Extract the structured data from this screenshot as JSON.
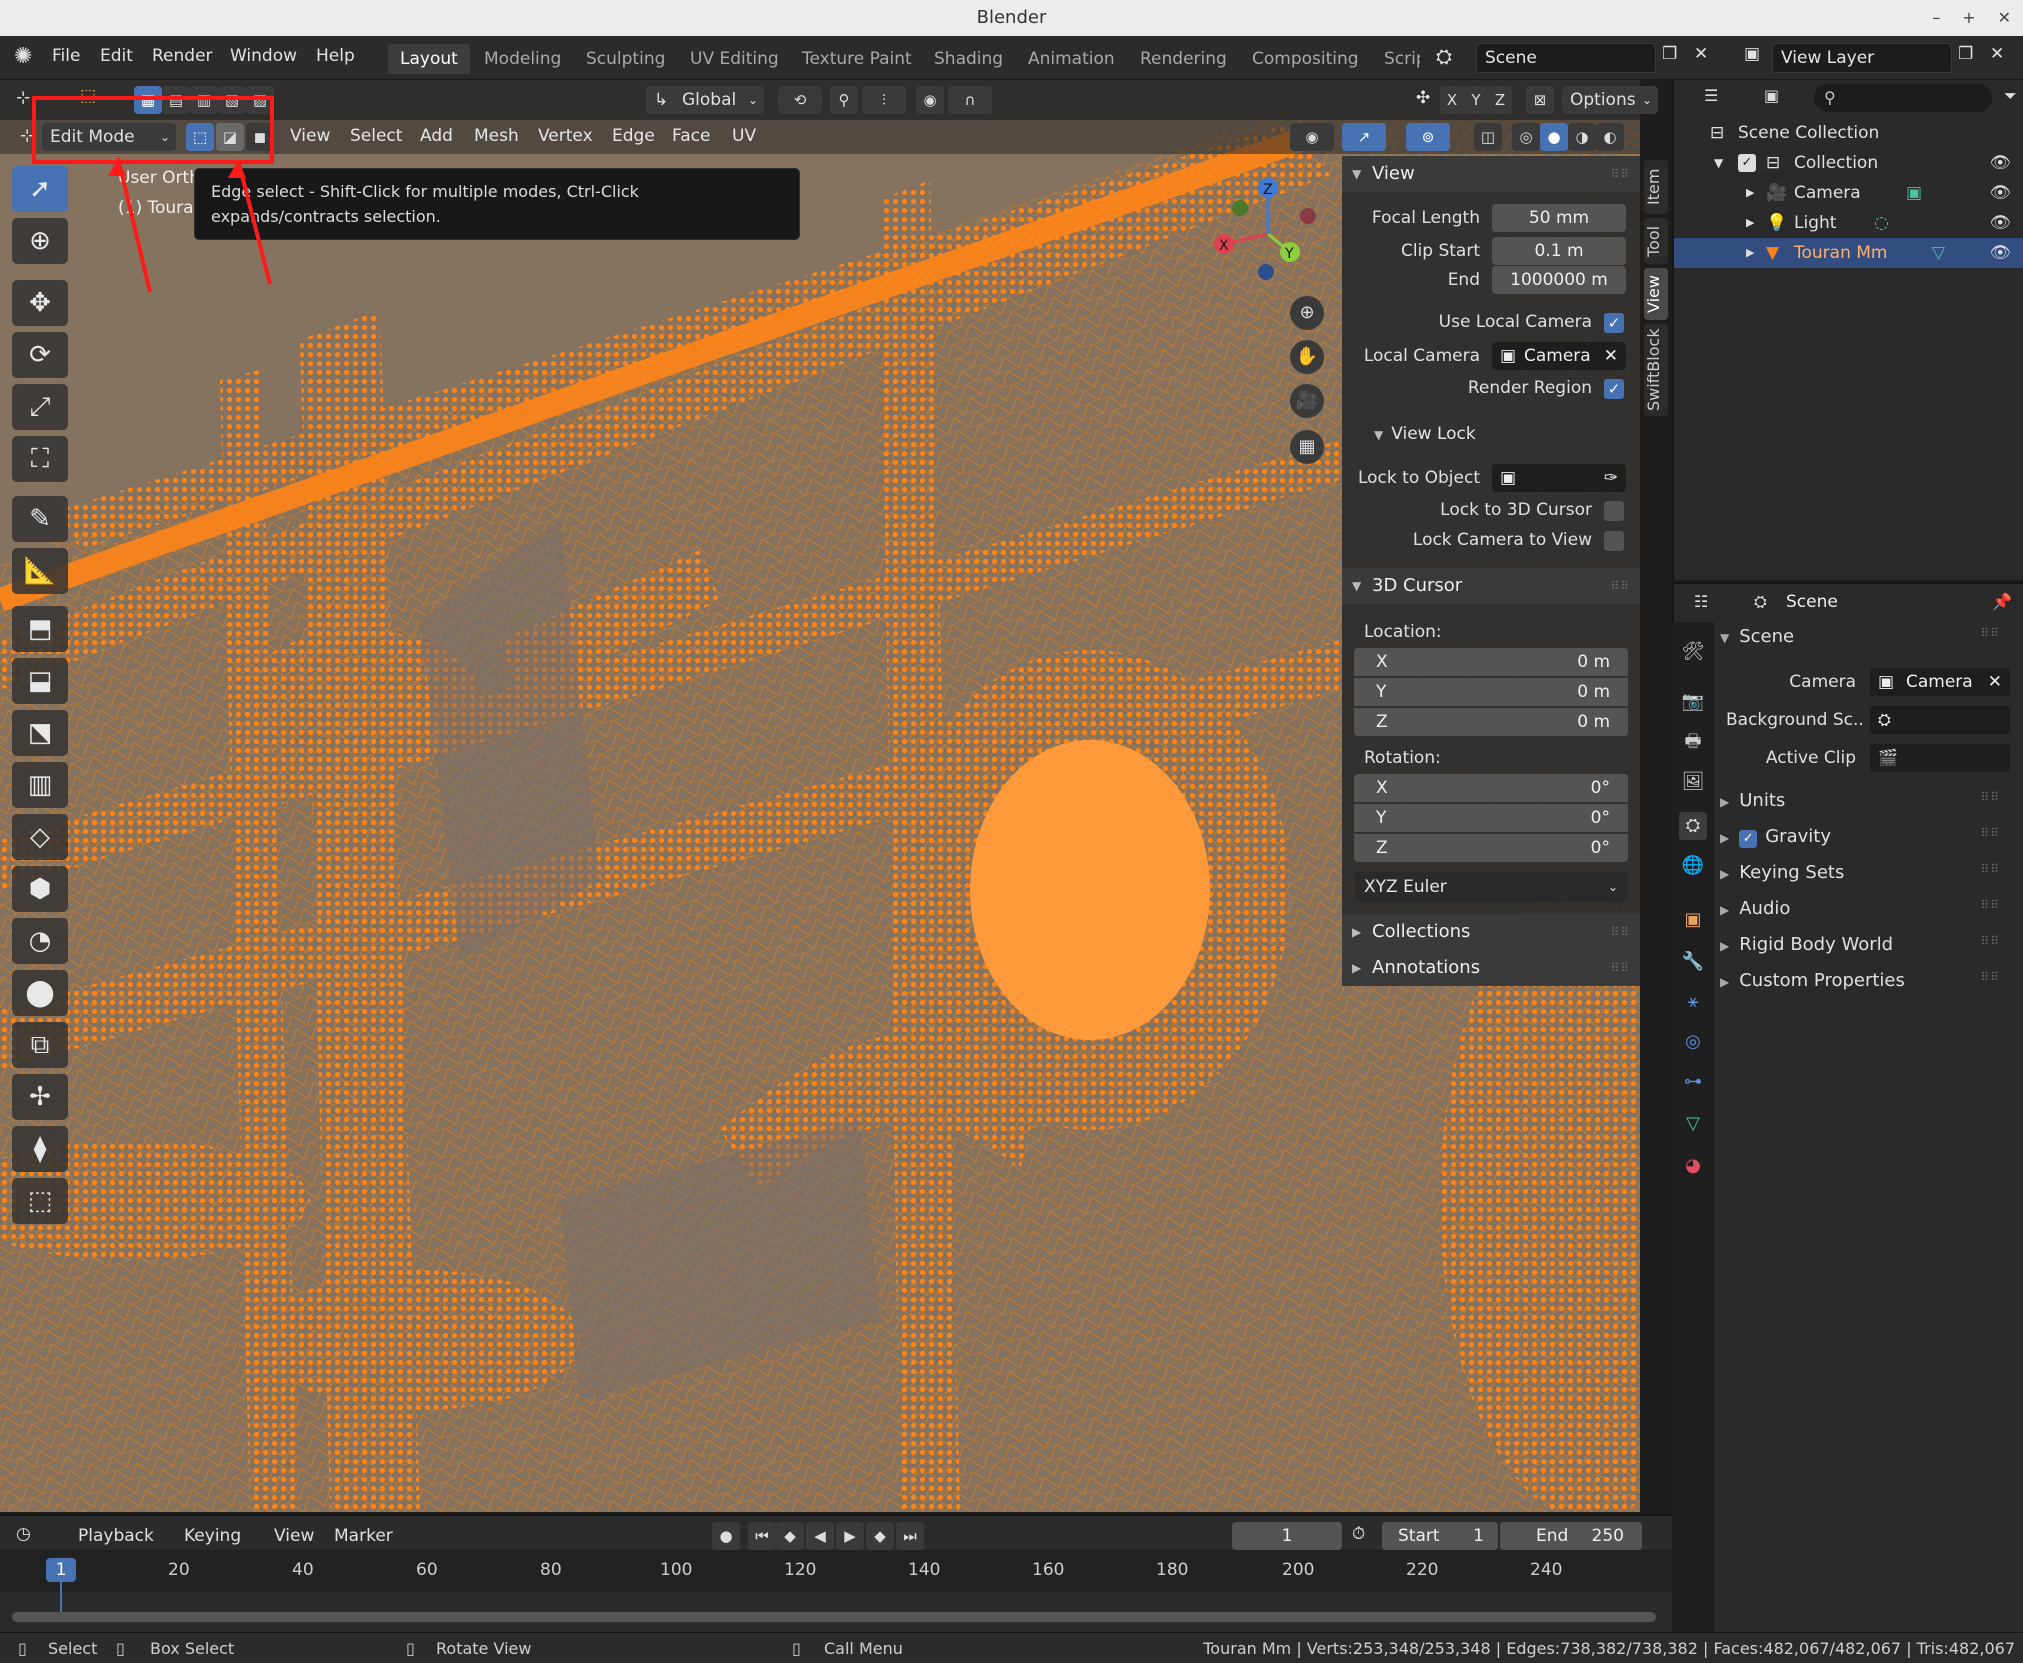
{
  "window": {
    "title": "Blender"
  },
  "menu": {
    "file": "File",
    "edit": "Edit",
    "render": "Render",
    "window": "Window",
    "help": "Help"
  },
  "workspaces": [
    "Layout",
    "Modeling",
    "Sculpting",
    "UV Editing",
    "Texture Paint",
    "Shading",
    "Animation",
    "Rendering",
    "Compositing",
    "Scrip"
  ],
  "scene_field": "Scene",
  "view_layer_field": "View Layer",
  "viewport": {
    "transform_orientation": "Global",
    "options_label": "Options",
    "mode": "Edit Mode",
    "header_menus": [
      "View",
      "Select",
      "Add",
      "Mesh",
      "Vertex",
      "Edge",
      "Face",
      "UV"
    ],
    "overlay_text_1": "User Ortho",
    "overlay_text_2": "(1) Touran Mm",
    "axis_x": "X",
    "axis_y": "Y",
    "axis_z": "Z",
    "tooltip": "Edge select - Shift-Click for multiple modes, Ctrl-Click expands/contracts selection.",
    "mesh_color": "#ff8418",
    "accent_color": "#4772b3",
    "annotation_color": "#ff1a1a"
  },
  "npanel": {
    "tabs": [
      "Item",
      "Tool",
      "View",
      "SwiftBlock"
    ],
    "view_header": "View",
    "focal_length_label": "Focal Length",
    "focal_length": "50 mm",
    "clip_start_label": "Clip Start",
    "clip_start": "0.1 m",
    "clip_end_label": "End",
    "clip_end": "1000000 m",
    "use_local_camera_label": "Use Local Camera",
    "local_camera_label": "Local Camera",
    "local_camera": "Camera",
    "render_region_label": "Render Region",
    "view_lock_header": "View Lock",
    "lock_to_object_label": "Lock to Object",
    "lock_3d_cursor_label": "Lock to 3D Cursor",
    "lock_camera_label": "Lock Camera to View",
    "cursor_header": "3D Cursor",
    "location_label": "Location:",
    "location": [
      {
        "axis": "X",
        "value": "0 m"
      },
      {
        "axis": "Y",
        "value": "0 m"
      },
      {
        "axis": "Z",
        "value": "0 m"
      }
    ],
    "rotation_label": "Rotation:",
    "rotation": [
      {
        "axis": "X",
        "value": "0°"
      },
      {
        "axis": "Y",
        "value": "0°"
      },
      {
        "axis": "Z",
        "value": "0°"
      }
    ],
    "rotation_mode": "XYZ Euler",
    "collections_header": "Collections",
    "annotations_header": "Annotations"
  },
  "outliner": {
    "scene_collection": "Scene Collection",
    "collection": "Collection",
    "items": [
      "Camera",
      "Light",
      "Touran Mm"
    ]
  },
  "properties": {
    "header": "Scene",
    "panel": "Scene",
    "camera_label": "Camera",
    "camera_value": "Camera",
    "background_label": "Background Sc..",
    "active_clip_label": "Active Clip",
    "sections": [
      "Units",
      "Gravity",
      "Keying Sets",
      "Audio",
      "Rigid Body World",
      "Custom Properties"
    ]
  },
  "timeline": {
    "menus": [
      "Playback",
      "Keying",
      "View",
      "Marker"
    ],
    "current_frame": "1",
    "start_label": "Start",
    "start": "1",
    "end_label": "End",
    "end": "250",
    "ruler": [
      "20",
      "40",
      "60",
      "80",
      "100",
      "120",
      "140",
      "160",
      "180",
      "200",
      "220",
      "240"
    ],
    "playhead": "1"
  },
  "status": {
    "select": "Select",
    "box_select": "Box Select",
    "rotate_view": "Rotate View",
    "call_menu": "Call Menu",
    "stats": "Touran Mm | Verts:253,348/253,348 | Edges:738,382/738,382 | Faces:482,067/482,067 | Tris:482,067"
  }
}
